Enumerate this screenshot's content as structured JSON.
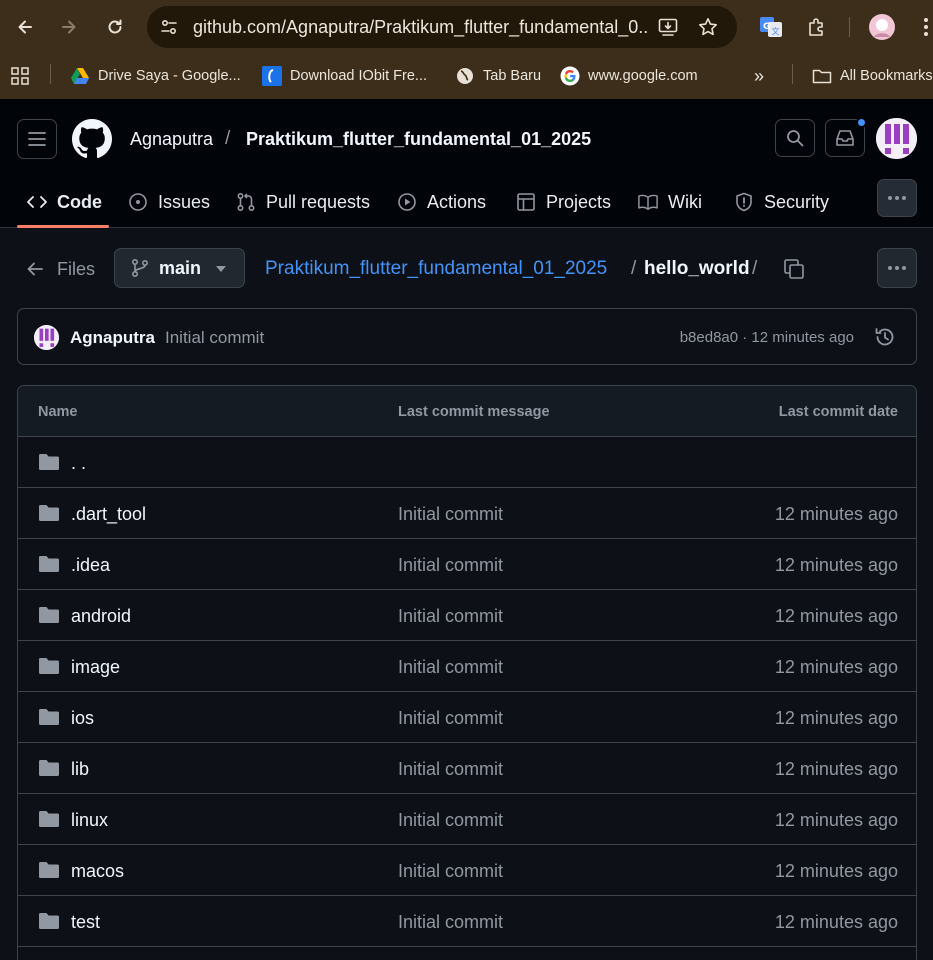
{
  "browser": {
    "url": "github.com/Agnaputra/Praktikum_flutter_fundamental_0...",
    "bookmarks": [
      {
        "label": "Drive Saya - Google..."
      },
      {
        "label": "Download IObit Fre..."
      },
      {
        "label": "Tab Baru"
      },
      {
        "label": "www.google.com"
      }
    ],
    "overflow": "»",
    "all_bookmarks": "All Bookmarks"
  },
  "repo": {
    "owner": "Agnaputra",
    "separator": "/",
    "name": "Praktikum_flutter_fundamental_01_2025"
  },
  "tabs": [
    {
      "label": "Code",
      "icon": "code-icon",
      "active": true
    },
    {
      "label": "Issues",
      "icon": "issue-icon"
    },
    {
      "label": "Pull requests",
      "icon": "pull-request-icon"
    },
    {
      "label": "Actions",
      "icon": "play-icon"
    },
    {
      "label": "Projects",
      "icon": "table-icon"
    },
    {
      "label": "Wiki",
      "icon": "book-icon"
    },
    {
      "label": "Security",
      "icon": "shield-icon"
    }
  ],
  "file_nav": {
    "files_label": "Files",
    "branch": "main",
    "crumb_repo": "Praktikum_flutter_fundamental_01_2025",
    "crumb_sep": "/",
    "crumb_current": "hello_world",
    "crumb_trailing": "/"
  },
  "commit": {
    "author": "Agnaputra",
    "message": "Initial commit",
    "meta": "b8ed8a0 · 12 minutes ago"
  },
  "table": {
    "headers": {
      "name": "Name",
      "message": "Last commit message",
      "date": "Last commit date"
    },
    "rows": [
      {
        "name": ". .",
        "message": "",
        "date": ""
      },
      {
        "name": ".dart_tool",
        "message": "Initial commit",
        "date": "12 minutes ago"
      },
      {
        "name": ".idea",
        "message": "Initial commit",
        "date": "12 minutes ago"
      },
      {
        "name": "android",
        "message": "Initial commit",
        "date": "12 minutes ago"
      },
      {
        "name": "image",
        "message": "Initial commit",
        "date": "12 minutes ago"
      },
      {
        "name": "ios",
        "message": "Initial commit",
        "date": "12 minutes ago"
      },
      {
        "name": "lib",
        "message": "Initial commit",
        "date": "12 minutes ago"
      },
      {
        "name": "linux",
        "message": "Initial commit",
        "date": "12 minutes ago"
      },
      {
        "name": "macos",
        "message": "Initial commit",
        "date": "12 minutes ago"
      },
      {
        "name": "test",
        "message": "Initial commit",
        "date": "12 minutes ago"
      }
    ]
  },
  "colors": {
    "accent_link": "#4493f8",
    "tab_underline": "#f78166",
    "folder": "#9198a1"
  }
}
